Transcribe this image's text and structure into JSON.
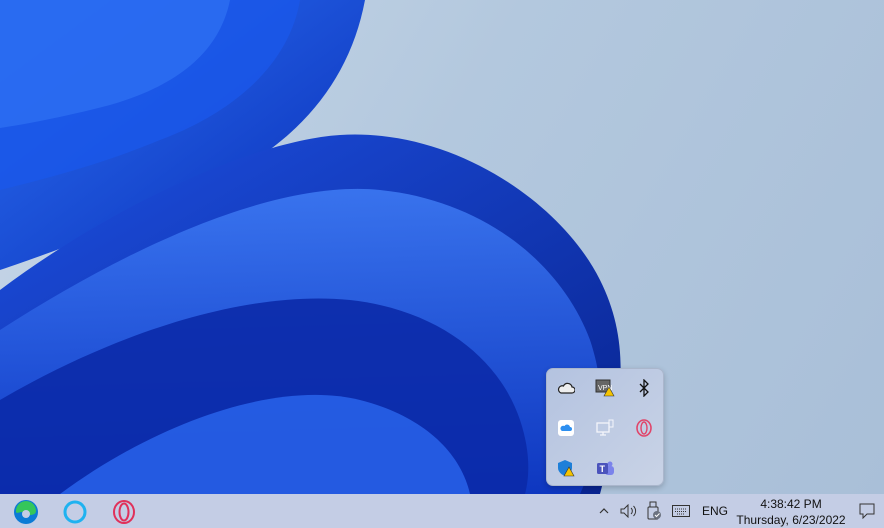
{
  "taskbar": {
    "pinned": [
      {
        "name": "Microsoft Edge",
        "icon": "edge-icon"
      },
      {
        "name": "Cortana",
        "icon": "cortana-icon"
      },
      {
        "name": "Opera",
        "icon": "opera-icon"
      }
    ],
    "tray": {
      "show_hidden_icon": "chevron-up-icon",
      "volume_icon": "speaker-icon",
      "usb_icon": "usb-safe-remove-icon",
      "keyboard_icon": "touch-keyboard-icon",
      "language": "ENG",
      "time": "4:38:42 PM",
      "date": "Thursday, 6/23/2022",
      "notifications_icon": "action-center-icon"
    }
  },
  "overflow_flyout": {
    "icons": [
      "onedrive-icon",
      "vpn-warning-icon",
      "bluetooth-icon",
      "icloud-icon",
      "network-icon",
      "opera-icon",
      "defender-warning-icon",
      "teams-icon"
    ]
  },
  "colors": {
    "accent": "#1446d6",
    "taskbar": "#c4cde5"
  }
}
